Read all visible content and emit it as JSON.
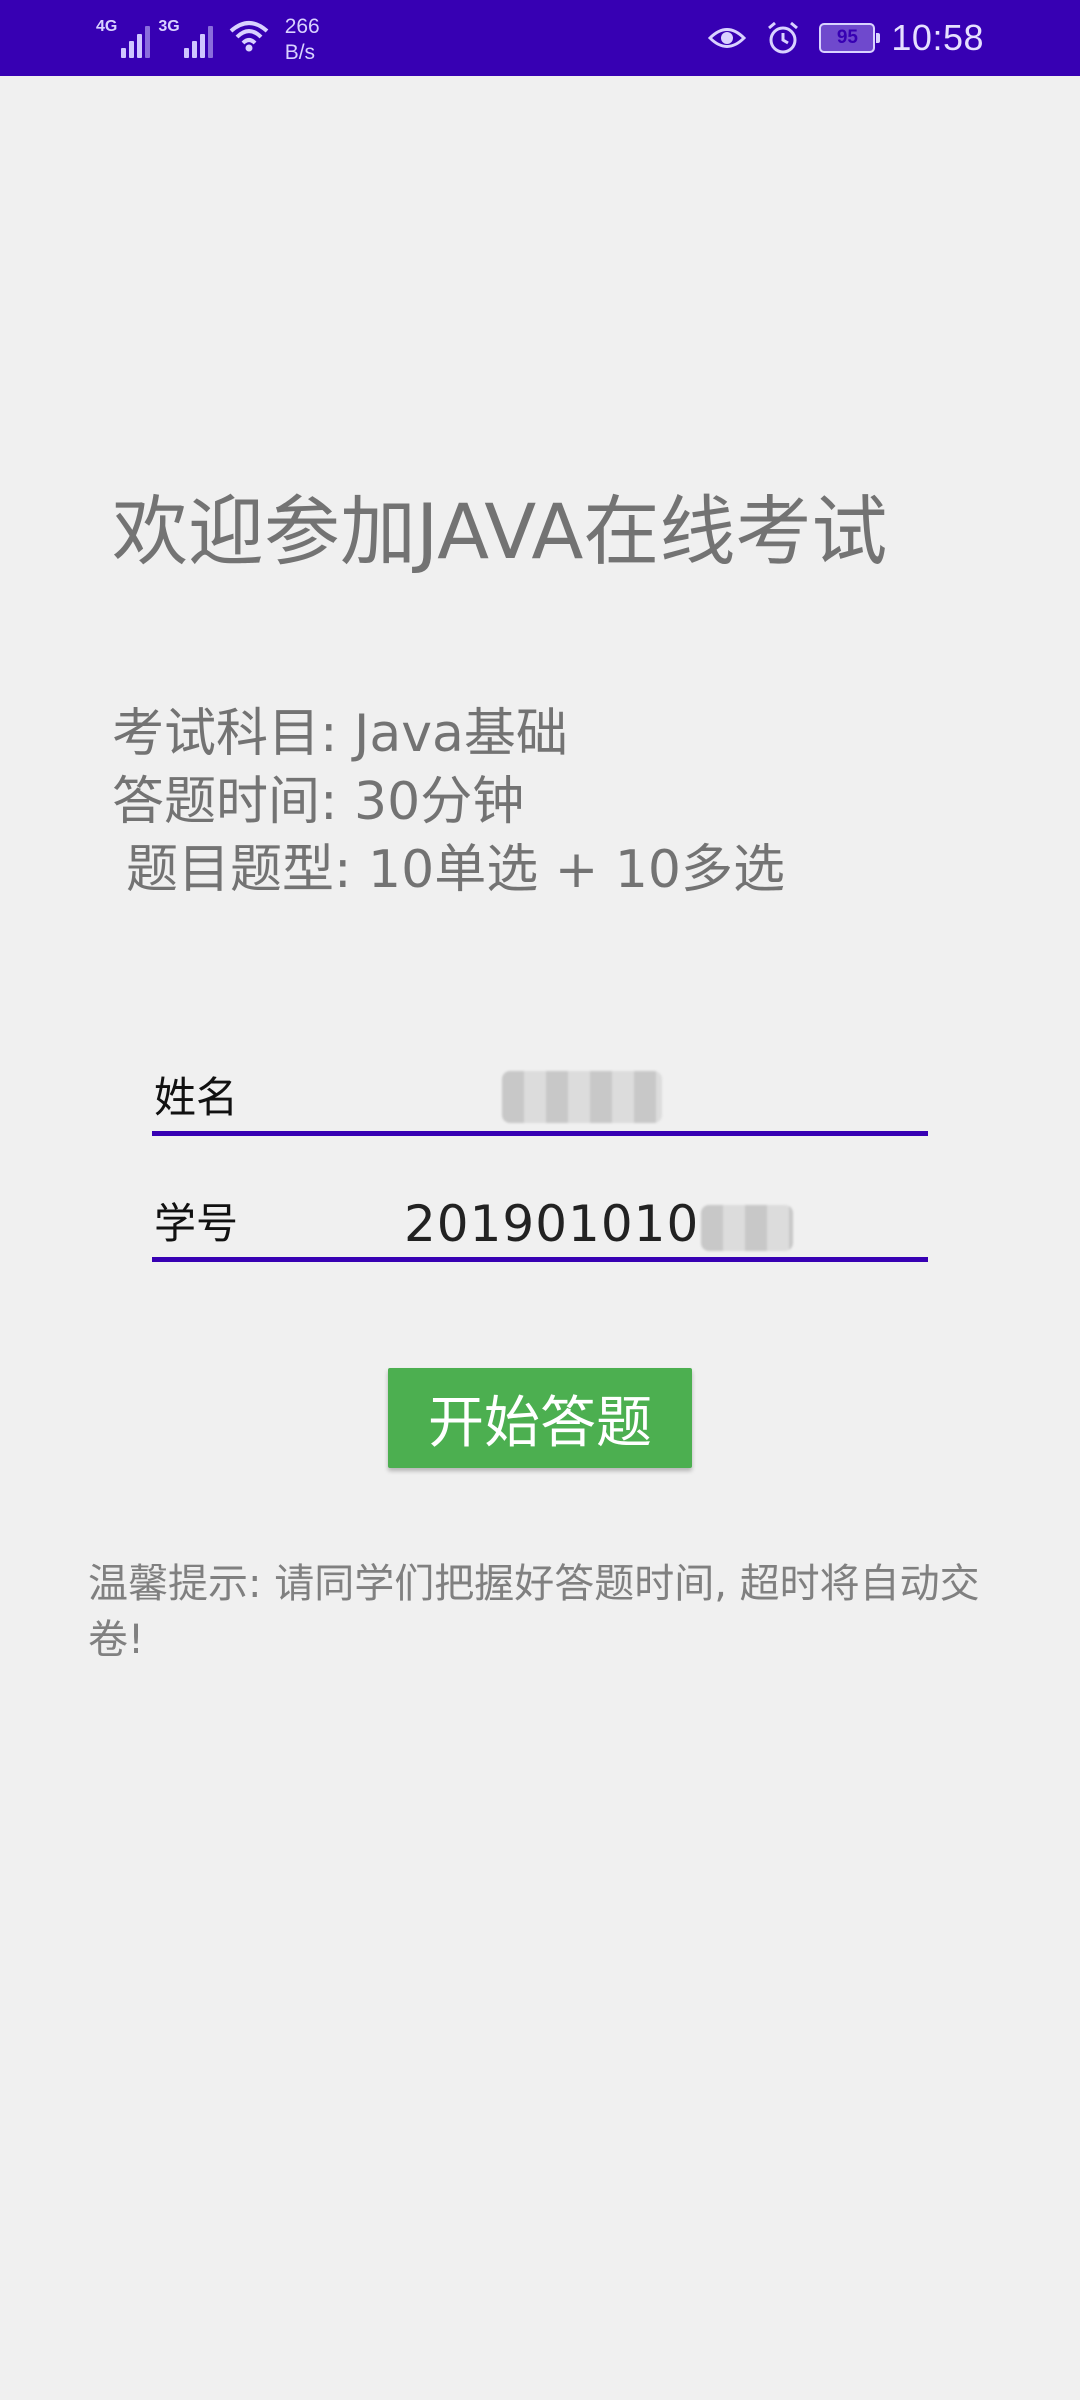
{
  "status_bar": {
    "net1_type": "4G",
    "net2_type": "3G",
    "speed_value": "266",
    "speed_unit": "B/s",
    "battery_level": "95",
    "time": "10:58"
  },
  "title": "欢迎参加JAVA在线考试",
  "exam_info": {
    "subject": "考试科目: Java基础",
    "duration": "答题时间: 30分钟",
    "question_types": "题目题型: 10单选 + 10多选"
  },
  "form": {
    "name_label": "姓名",
    "name_value": "",
    "id_label": "学号",
    "id_value": "201901010"
  },
  "start_button": "开始答题",
  "tip": "温馨提示: 请同学们把握好答题时间, 超时将自动交卷!"
}
